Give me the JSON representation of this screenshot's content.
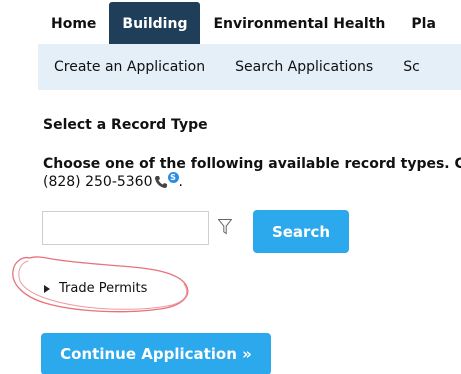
{
  "top_tabs": [
    {
      "label": "Home"
    },
    {
      "label": "Building"
    },
    {
      "label": "Environmental Health"
    },
    {
      "label": "Pla"
    }
  ],
  "active_tab": "Building",
  "sub_nav": [
    {
      "label": "Create an Application"
    },
    {
      "label": "Search Applications"
    },
    {
      "label": "Sc"
    }
  ],
  "section_title": "Select a Record Type",
  "instructions": "Choose one of the following available record types.  Cli",
  "phone": "(828) 250-5360",
  "phone_suffix": ".",
  "skype_badge": "S",
  "search": {
    "value": "",
    "button_label": "Search"
  },
  "record_types": [
    {
      "label": "Trade Permits",
      "expanded": false
    }
  ],
  "continue_button": "Continue Application »",
  "colors": {
    "active_tab_bg": "#1f3e5a",
    "subnav_bg": "#e4eff7",
    "button_bg": "#2ca8ec",
    "annotation": "#e8727a"
  }
}
